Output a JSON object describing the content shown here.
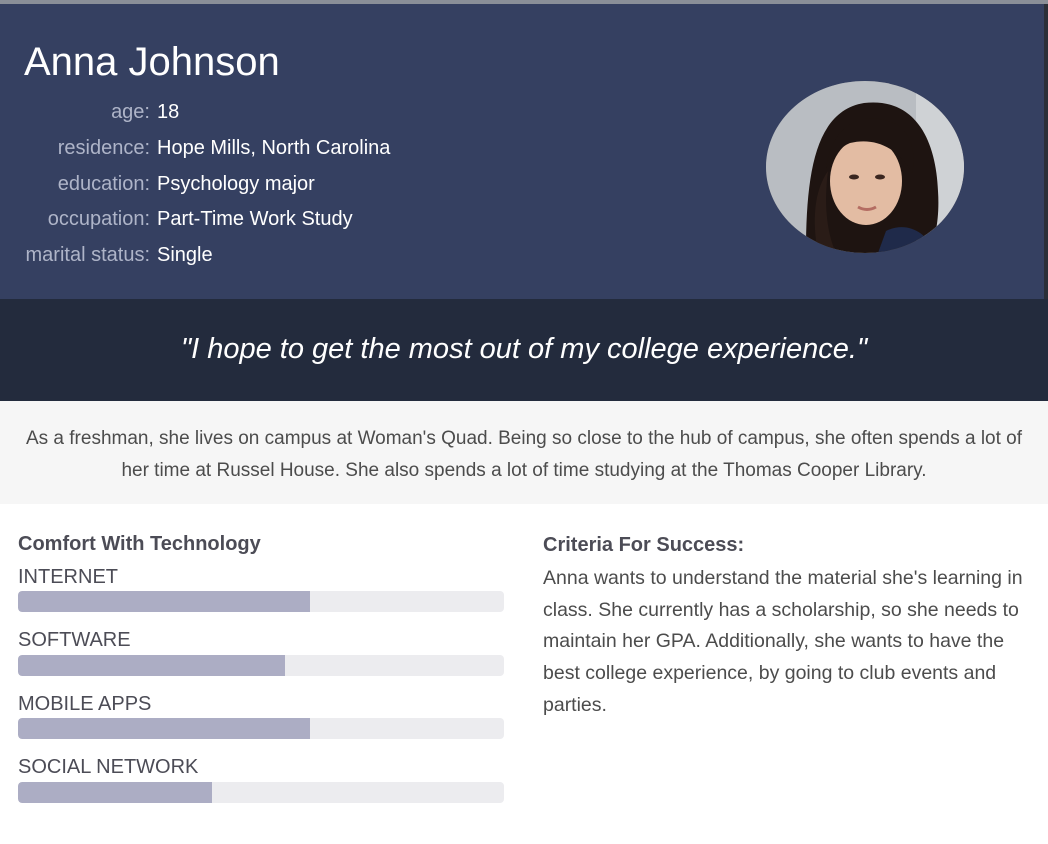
{
  "profile": {
    "name": "Anna Johnson",
    "details": [
      {
        "label": "age:",
        "value": "18"
      },
      {
        "label": "residence:",
        "value": "Hope Mills, North Carolina"
      },
      {
        "label": "education:",
        "value": "Psychology major"
      },
      {
        "label": "occupation:",
        "value": "Part-Time Work Study"
      },
      {
        "label": "marital status:",
        "value": "Single"
      }
    ],
    "photo_icon": "person-photo"
  },
  "quote": "\"I hope to get the most out of my college experience.\"",
  "bio": "As a freshman, she lives on campus at Woman's Quad. Being so close to the hub of campus, she often spends a lot of her time at Russel House. She also spends a lot of time studying at the Thomas Cooper Library.",
  "technology": {
    "title": "Comfort With Technology",
    "skills": [
      {
        "label": "INTERNET",
        "level": 0.6
      },
      {
        "label": "SOFTWARE",
        "level": 0.55
      },
      {
        "label": "MOBILE APPS",
        "level": 0.6
      },
      {
        "label": "SOCIAL NETWORK",
        "level": 0.4
      }
    ]
  },
  "criteria": {
    "title": "Criteria For Success:",
    "text": "Anna wants to understand the material she's learning in class. She currently has a scholarship, so she needs to maintain her GPA. Additionally, she wants to have the best college experience, by going to club events and parties."
  },
  "colors": {
    "header_bg": "#354061",
    "quote_bg": "#232b3d",
    "bar_fill": "#acadc4",
    "bar_track": "#ececef"
  }
}
